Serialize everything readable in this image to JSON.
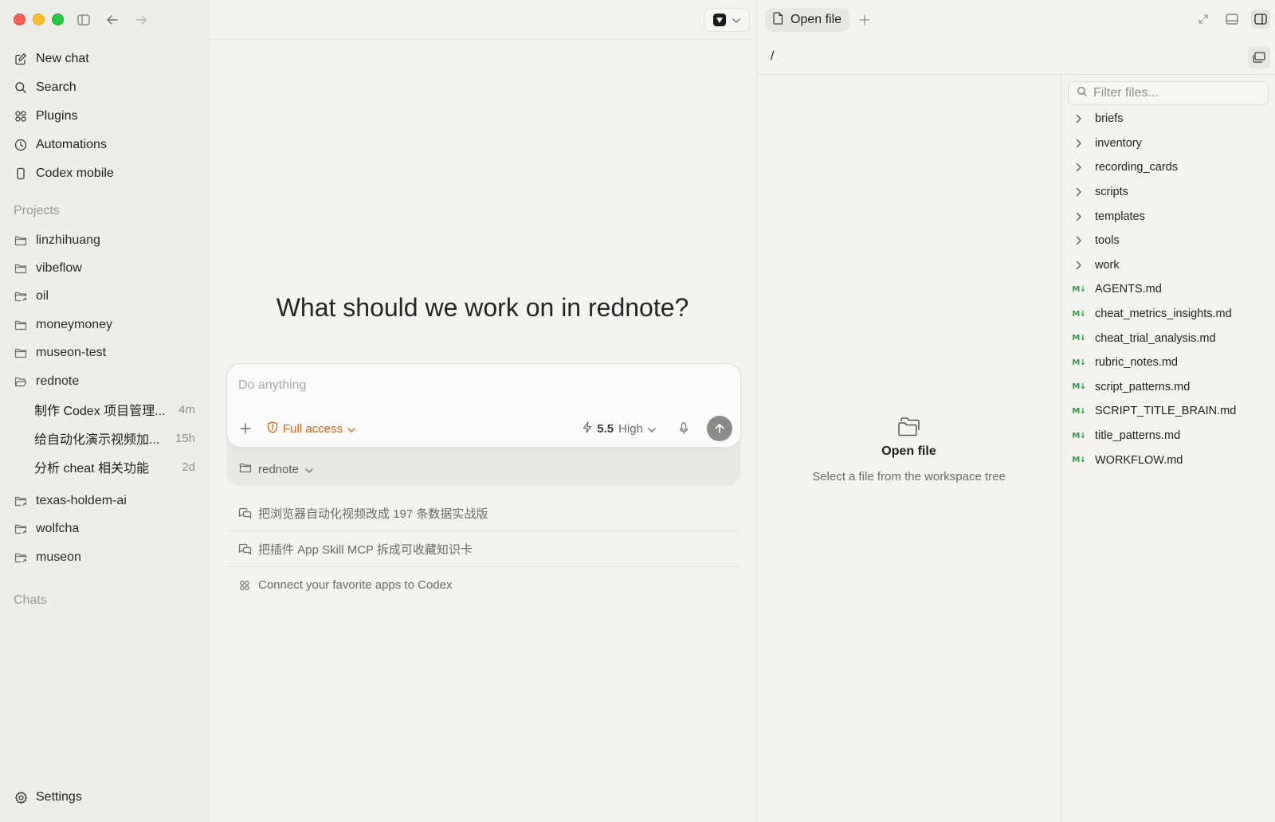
{
  "sidebar": {
    "nav": [
      {
        "label": "New chat",
        "icon": "compose-icon"
      },
      {
        "label": "Search",
        "icon": "search-icon"
      },
      {
        "label": "Plugins",
        "icon": "grid-icon"
      },
      {
        "label": "Automations",
        "icon": "clock-icon"
      },
      {
        "label": "Codex mobile",
        "icon": "phone-icon"
      }
    ],
    "projects_label": "Projects",
    "projects": [
      "linzhihuang",
      "vibeflow",
      "oil",
      "moneymoney",
      "museon-test",
      "rednote"
    ],
    "rednote_chats": [
      {
        "title": "制作 Codex 项目管理...",
        "age": "4m"
      },
      {
        "title": "给自动化演示视频加...",
        "age": "15h"
      },
      {
        "title": "分析 cheat 相关功能",
        "age": "2d"
      }
    ],
    "projects_more": [
      "texas-holdem-ai",
      "wolfcha",
      "museon"
    ],
    "chats_label": "Chats",
    "settings_label": "Settings"
  },
  "main": {
    "headline": "What should we work on in rednote?",
    "composer": {
      "placeholder": "Do anything",
      "access_label": "Full access",
      "model_version": "5.5",
      "model_effort": "High"
    },
    "project_select": "rednote",
    "suggestions": [
      {
        "text": "把浏览器自动化视频改成 197 条数据实战版",
        "icon": "chat-icon"
      },
      {
        "text": "把插件 App Skill MCP 拆成可收藏知识卡",
        "icon": "chat-icon"
      },
      {
        "text": "Connect your favorite apps to Codex",
        "icon": "grid-icon"
      }
    ]
  },
  "right_panel": {
    "tab_label": "Open file",
    "path": "/",
    "empty_title": "Open file",
    "empty_subtitle": "Select a file from the workspace tree",
    "filter_placeholder": "Filter files...",
    "folders": [
      "briefs",
      "inventory",
      "recording_cards",
      "scripts",
      "templates",
      "tools",
      "work"
    ],
    "md_badge": "M↓",
    "files": [
      "AGENTS.md",
      "cheat_metrics_insights.md",
      "cheat_trial_analysis.md",
      "rubric_notes.md",
      "script_patterns.md",
      "SCRIPT_TITLE_BRAIN.md",
      "title_patterns.md",
      "WORKFLOW.md"
    ]
  },
  "colors": {
    "accent_orange": "#d9640e",
    "md_green": "#2ea043",
    "background": "#f4f3ee",
    "sidebar": "#eeede7"
  }
}
